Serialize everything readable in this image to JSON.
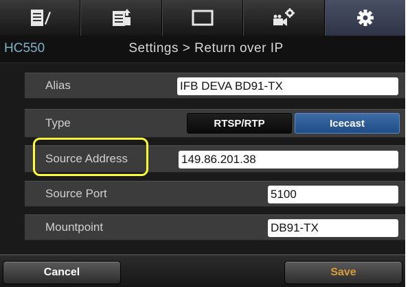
{
  "tabs": [
    {
      "icon": "list-edit-icon",
      "active": false
    },
    {
      "icon": "list-upload-icon",
      "active": false
    },
    {
      "icon": "monitor-icon",
      "active": false
    },
    {
      "icon": "camera-settings-icon",
      "active": false
    },
    {
      "icon": "gear-icon",
      "active": true
    }
  ],
  "header": {
    "device_name": "HC550",
    "title": "Settings > Return over IP"
  },
  "rows": {
    "alias": {
      "label": "Alias",
      "value": "IFB DEVA BD91-TX"
    },
    "type": {
      "label": "Type",
      "options": [
        "RTSP/RTP",
        "Icecast"
      ],
      "selected": "Icecast"
    },
    "source_address": {
      "label": "Source Address",
      "value": "149.86.201.38"
    },
    "source_port": {
      "label": "Source Port",
      "value": "5100"
    },
    "mountpoint": {
      "label": "Mountpoint",
      "value": "DB91-TX"
    }
  },
  "footer": {
    "cancel_label": "Cancel",
    "save_label": "Save"
  },
  "colors": {
    "accent": "#2a5a96",
    "highlight": "#ffff3a",
    "save_text": "#d89b3a",
    "device_name": "#7fb1c8"
  }
}
